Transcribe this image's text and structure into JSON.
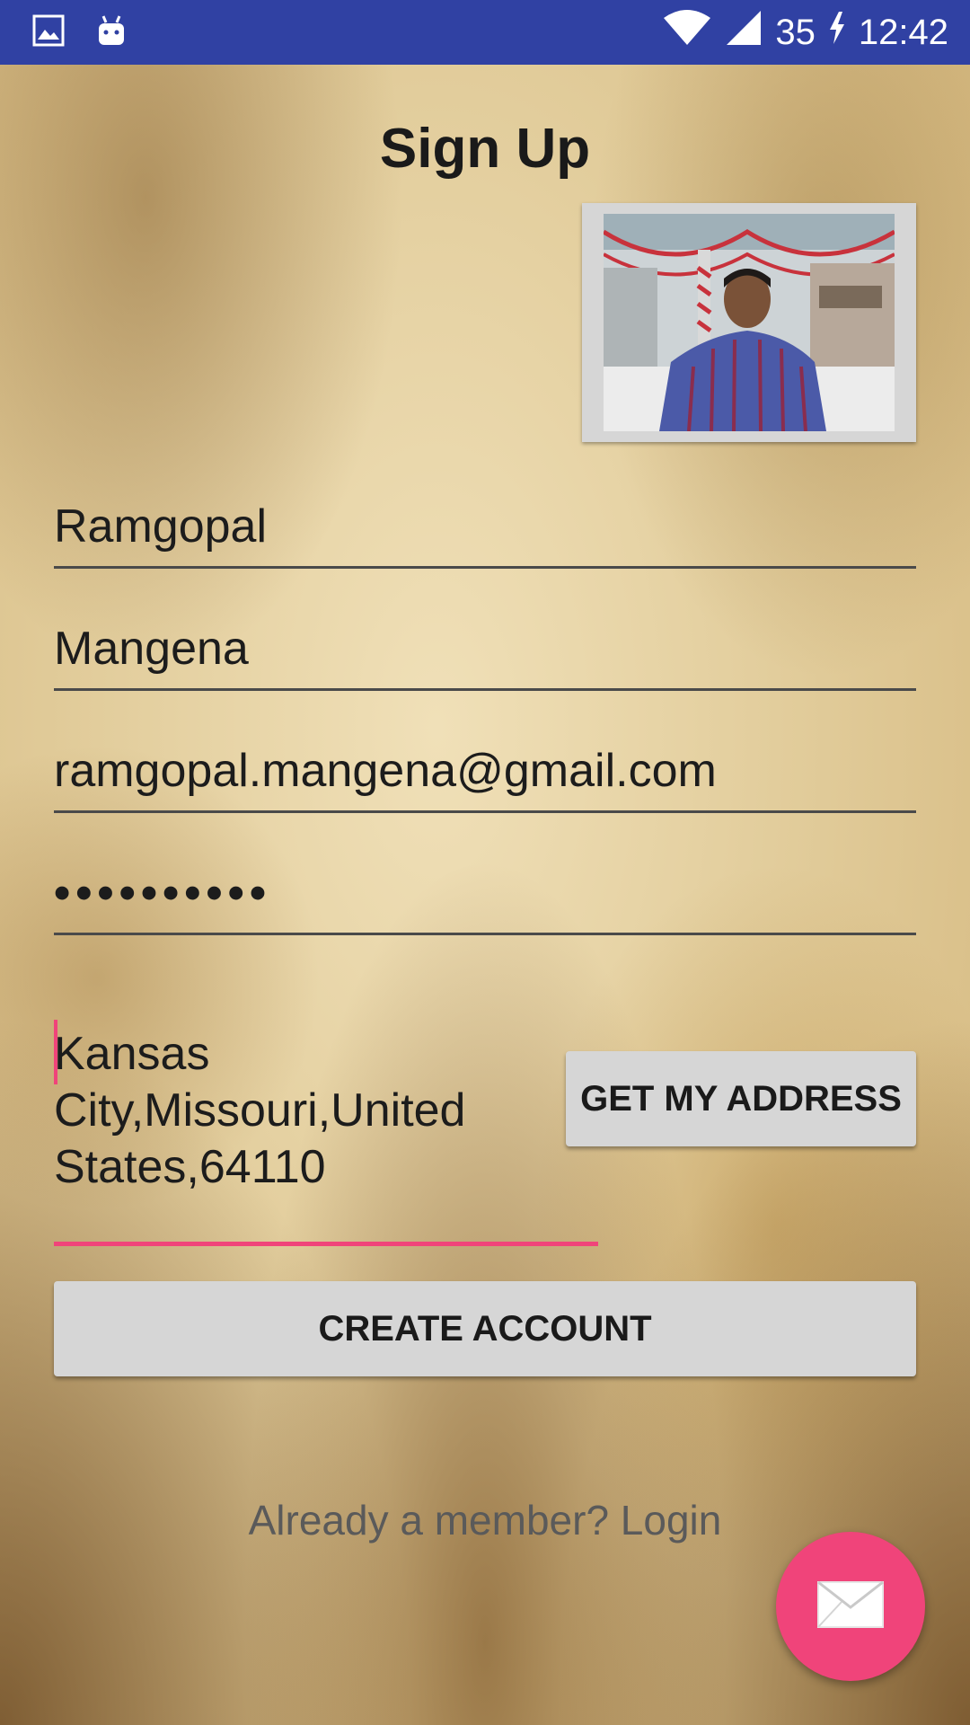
{
  "status_bar": {
    "left_icons": [
      "image-icon",
      "android-icon"
    ],
    "battery": "35",
    "time": "12:42"
  },
  "page": {
    "title": "Sign Up"
  },
  "form": {
    "first_name": "Ramgopal",
    "last_name": "Mangena",
    "email": "ramgopal.mangena@gmail.com",
    "password_masked": "••••••••••",
    "address": "Kansas\nCity,Missouri,United\nStates,64110",
    "get_address_label": "GET MY ADDRESS",
    "create_account_label": "CREATE ACCOUNT",
    "login_prompt": "Already a member? Login"
  },
  "fab": {
    "icon": "mail-icon"
  },
  "colors": {
    "status_bar": "#3041a3",
    "accent": "#f0447a",
    "button": "#d6d6d6"
  }
}
